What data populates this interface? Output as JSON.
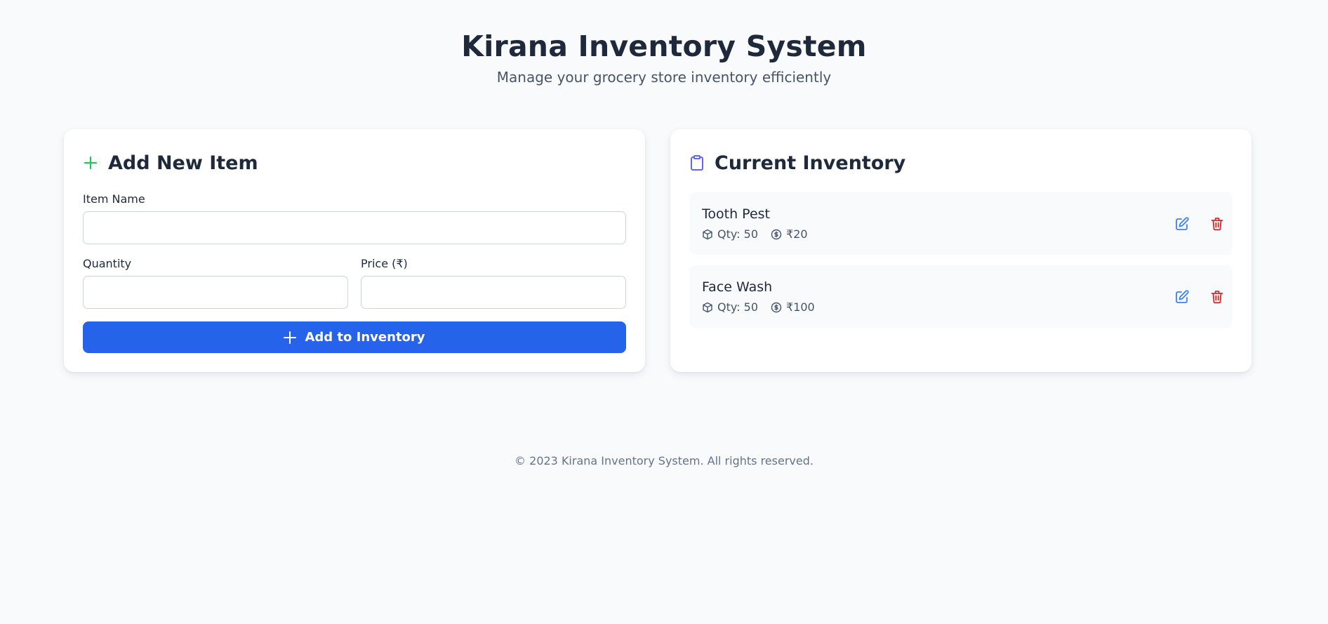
{
  "header": {
    "title": "Kirana Inventory System",
    "subtitle": "Manage your grocery store inventory efficiently"
  },
  "add_form": {
    "title": "Add New Item",
    "item_name_label": "Item Name",
    "item_name_value": "",
    "quantity_label": "Quantity",
    "quantity_value": "",
    "price_label": "Price (₹)",
    "price_value": "",
    "submit_label": "Add to Inventory"
  },
  "inventory": {
    "title": "Current Inventory",
    "items": [
      {
        "name": "Tooth Pest",
        "qty": "Qty: 50",
        "price": "₹20"
      },
      {
        "name": "Face Wash",
        "qty": "Qty: 50",
        "price": "₹100"
      }
    ]
  },
  "footer": {
    "text": "© 2023 Kirana Inventory System. All rights reserved."
  },
  "icons": {
    "add_item": "plus-icon",
    "inventory": "clipboard-icon",
    "submit": "plus-icon",
    "qty": "box-icon",
    "price": "dollar-circle-icon",
    "edit": "edit-icon",
    "delete": "trash-icon"
  },
  "colors": {
    "primary": "#2563eb",
    "plus_green": "#22c55e",
    "clipboard_indigo": "#6366f1",
    "edit_blue": "#3b82f6",
    "delete_red": "#dc2626",
    "page_bg": "#f8fafc"
  }
}
